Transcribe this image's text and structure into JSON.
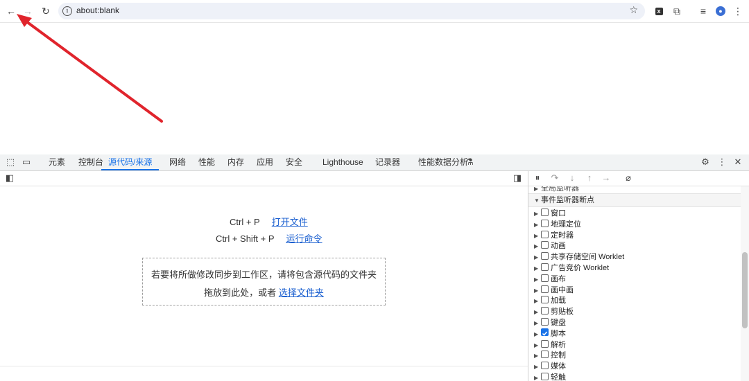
{
  "browser": {
    "url": "about:blank",
    "icons": [
      "back-arrow-icon",
      "forward-arrow-icon",
      "reload-icon",
      "info-icon",
      "star-icon",
      "extension-icon",
      "puzzle-icon",
      "media-icon",
      "profile-icon",
      "menu-icon"
    ]
  },
  "devtools": {
    "tabs": [
      "元素",
      "控制台",
      "源代码/来源",
      "网络",
      "性能",
      "内存",
      "应用",
      "安全",
      "Lighthouse",
      "记录器",
      "性能数据分析"
    ],
    "active_tab": "源代码/来源",
    "shortcuts": [
      {
        "keys": "Ctrl + P",
        "action": "打开文件"
      },
      {
        "keys": "Ctrl + Shift + P",
        "action": "运行命令"
      }
    ],
    "dropzone": {
      "line1": "若要将所做修改同步到工作区，请将包含源代码的文件夹",
      "line2": "拖放到此处，或者",
      "link": "选择文件夹"
    }
  },
  "breakpoints": {
    "partial_header": "全局监听器",
    "header": "事件监听器断点",
    "items": [
      {
        "label": "窗口",
        "checked": false
      },
      {
        "label": "地理定位",
        "checked": false
      },
      {
        "label": "定时器",
        "checked": false
      },
      {
        "label": "动画",
        "checked": false
      },
      {
        "label": "共享存储空间 Worklet",
        "checked": false
      },
      {
        "label": "广告竞价 Worklet",
        "checked": false
      },
      {
        "label": "画布",
        "checked": false
      },
      {
        "label": "画中画",
        "checked": false
      },
      {
        "label": "加载",
        "checked": false
      },
      {
        "label": "剪贴板",
        "checked": false
      },
      {
        "label": "键盘",
        "checked": false
      },
      {
        "label": "脚本",
        "checked": true
      },
      {
        "label": "解析",
        "checked": false
      },
      {
        "label": "控制",
        "checked": false
      },
      {
        "label": "媒体",
        "checked": false
      },
      {
        "label": "轻触",
        "checked": false
      }
    ]
  },
  "colors": {
    "accent": "#1a73e8",
    "annotation": "#e0242c",
    "link": "#1a5fd0"
  }
}
